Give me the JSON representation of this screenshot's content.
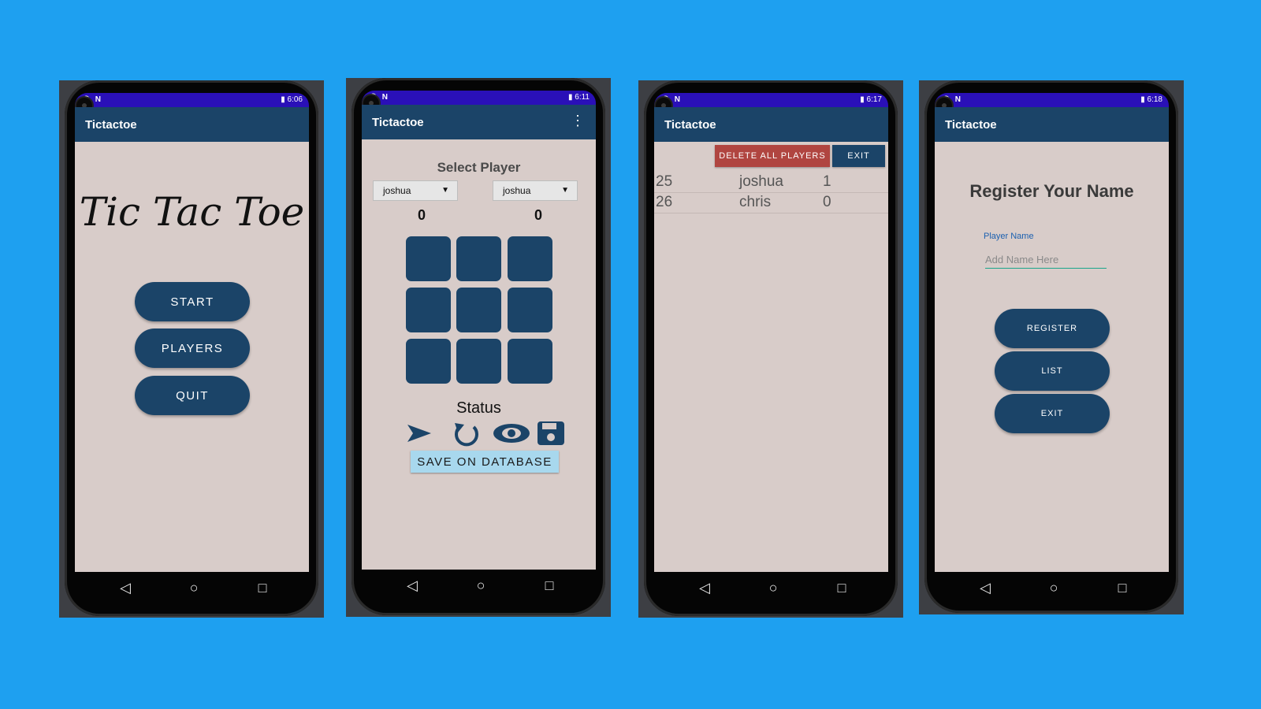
{
  "screens": [
    {
      "status_time": "6:06",
      "app_title": "Tictactoe",
      "logo_text": "Tic Tac Toe",
      "buttons": [
        "START",
        "PLAYERS",
        "QUIT"
      ]
    },
    {
      "status_time": "6:11",
      "app_title": "Tictactoe",
      "select_title": "Select Player",
      "player1": "joshua",
      "player2": "joshua",
      "score1": "0",
      "score2": "0",
      "status": "Status",
      "save_button": "SAVE ON DATABASE",
      "icons": [
        "play-icon",
        "replay-icon",
        "view-icon",
        "save-icon"
      ]
    },
    {
      "status_time": "6:17",
      "app_title": "Tictactoe",
      "delete_button": "DELETE ALL PLAYERS",
      "exit_button": "EXIT",
      "rows": [
        {
          "id": "25",
          "name": "joshua",
          "score": "1"
        },
        {
          "id": "26",
          "name": "chris",
          "score": "0"
        }
      ]
    },
    {
      "status_time": "6:18",
      "app_title": "Tictactoe",
      "title": "Register Your Name",
      "field_label": "Player Name",
      "placeholder": "Add Name Here",
      "buttons": [
        "REGISTER",
        "LIST",
        "EXIT"
      ]
    }
  ],
  "colors": {
    "background": "#1ea0f0",
    "status_bar": "#2a10b8",
    "app_bar": "#1b4468",
    "content": "#d8ccc9",
    "delete": "#b04540",
    "save_db": "#a8d8ee"
  }
}
